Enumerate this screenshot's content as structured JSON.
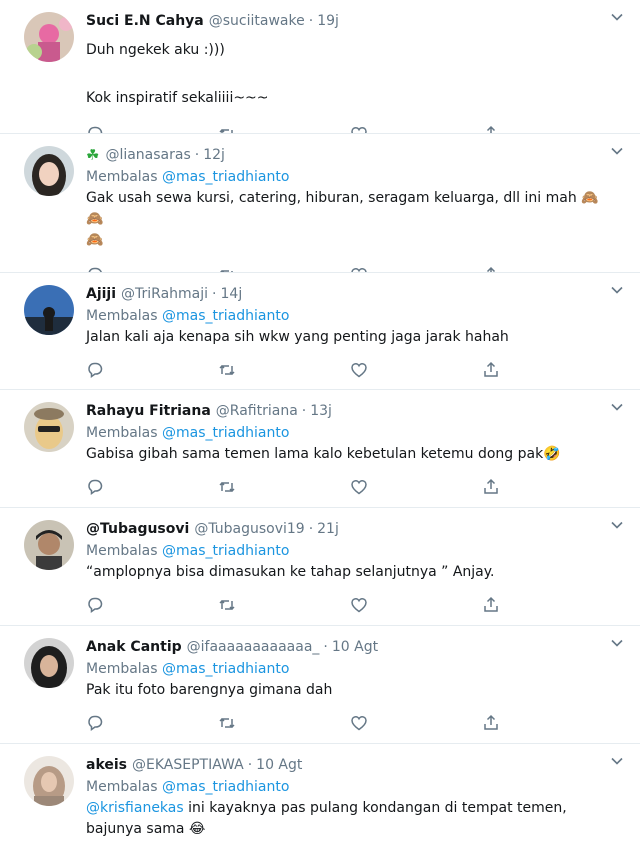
{
  "reply_prefix": "Membalas",
  "tweets": [
    {
      "name": "Suci E.N Cahya",
      "handle": "@suciitawake",
      "time": "19j",
      "reply_to": "",
      "text": "Duh ngekek aku :)))\n\nKok inspiratif sekaliiii~~~"
    },
    {
      "name": "",
      "handle": "@lianasaras",
      "time": "12j",
      "reply_to": "@mas_triadhianto",
      "text": "Gak usah sewa kursi, catering, hiburan, seragam keluarga, dll ini mah 🙈🙈",
      "text2": "🙈"
    },
    {
      "name": "Ajiji",
      "handle": "@TriRahmaji",
      "time": "14j",
      "reply_to": "@mas_triadhianto",
      "text": "Jalan kali aja kenapa sih wkw yang penting jaga jarak hahah"
    },
    {
      "name": "Rahayu Fitriana",
      "handle": "@Rafitriana",
      "time": "13j",
      "reply_to": "@mas_triadhianto",
      "text": "Gabisa gibah sama temen lama kalo kebetulan ketemu dong pak🤣"
    },
    {
      "name": "@Tubagusovi",
      "handle": "@Tubagusovi19",
      "time": "21j",
      "reply_to": "@mas_triadhianto",
      "text": "“amplopnya bisa dimasukan ke tahap selanjutnya ” Anjay."
    },
    {
      "name": "Anak Cantip",
      "handle": "@ifaaaaaaaaaaaa_",
      "time": "10 Agt",
      "reply_to": "@mas_triadhianto",
      "text": "Pak itu foto barengnya gimana dah"
    },
    {
      "name": "akeis",
      "handle": "@EKASEPTIAWA",
      "time": "10 Agt",
      "reply_to": "@mas_triadhianto",
      "mention": "@krisfianekas",
      "text": " ini kayaknya pas pulang kondangan di tempat temen, bajunya sama 😂"
    }
  ],
  "colors": {
    "link": "#1b95e0",
    "secondary_text": "#657786",
    "icon": "#657786",
    "divider": "#e6ecf0",
    "clover": "#2aa63a"
  },
  "icons": [
    "reply-icon",
    "retweet-icon",
    "like-icon",
    "share-icon",
    "caret-down-icon",
    "clover-icon"
  ]
}
